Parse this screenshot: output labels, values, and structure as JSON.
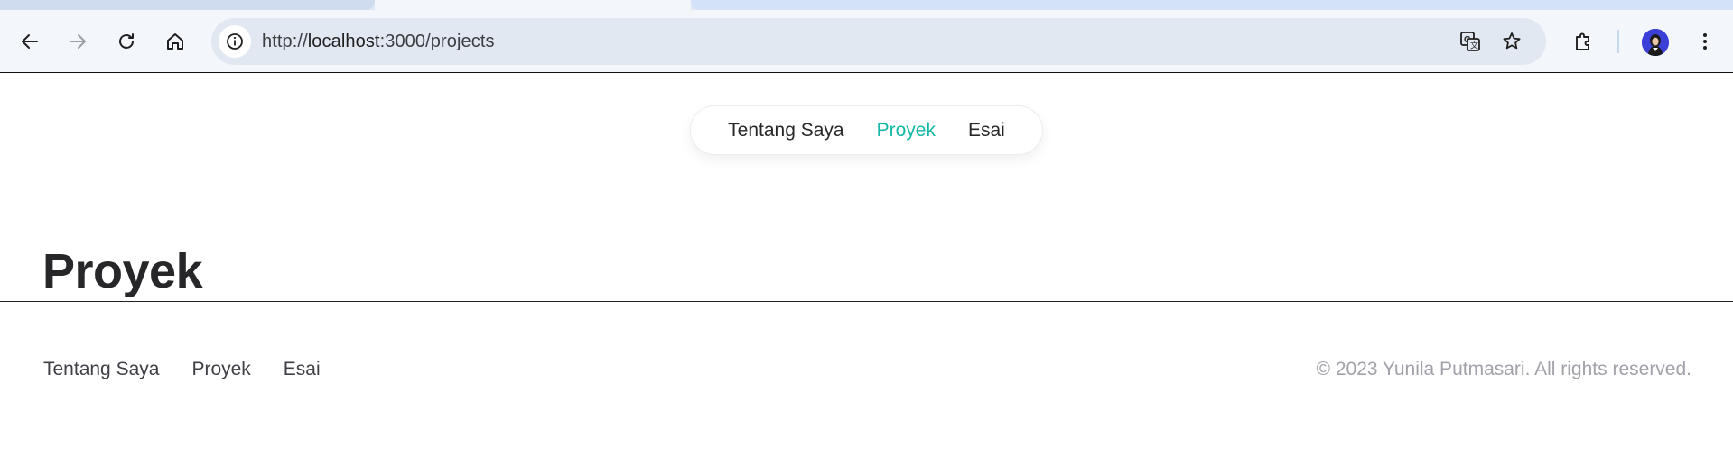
{
  "browser": {
    "url_scheme": "http://",
    "url_host": "localhost",
    "url_rest": ":3000/projects",
    "icons": {
      "back": "arrow-left-icon",
      "forward": "arrow-right-icon",
      "reload": "reload-icon",
      "home": "home-icon",
      "site_info": "info-icon",
      "translate": "translate-icon",
      "bookmark": "star-icon",
      "extensions": "puzzle-icon",
      "profile": "avatar",
      "menu": "kebab-menu-icon"
    }
  },
  "nav": {
    "items": [
      {
        "label": "Tentang Saya"
      },
      {
        "label": "Proyek"
      },
      {
        "label": "Esai"
      }
    ],
    "active_color": "#14b8a6"
  },
  "main": {
    "title": "Proyek"
  },
  "footer": {
    "links": [
      {
        "label": "Tentang Saya"
      },
      {
        "label": "Proyek"
      },
      {
        "label": "Esai"
      }
    ],
    "copyright": "© 2023 Yunila Putmasari. All rights reserved."
  }
}
